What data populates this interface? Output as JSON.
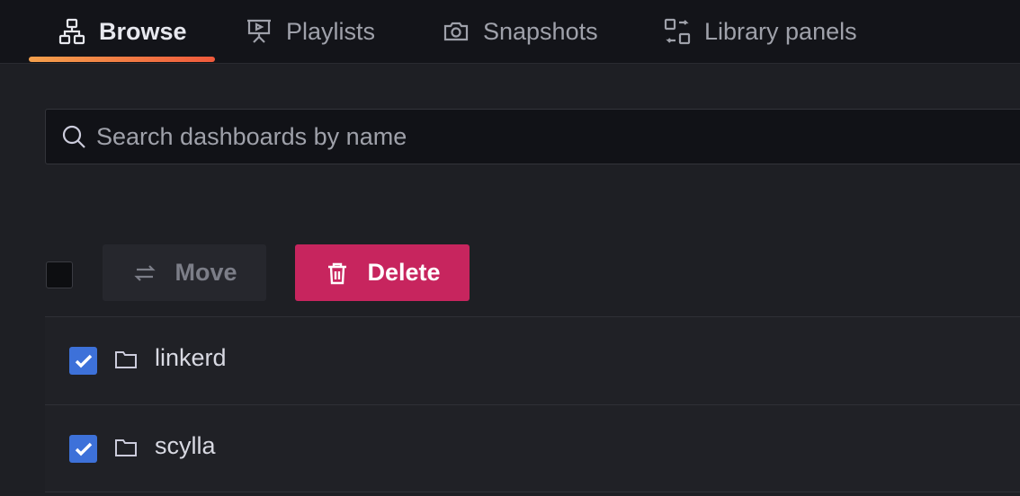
{
  "tabs": [
    {
      "label": "Browse",
      "icon": "sitemap-icon",
      "active": true
    },
    {
      "label": "Playlists",
      "icon": "presentation-icon",
      "active": false
    },
    {
      "label": "Snapshots",
      "icon": "camera-icon",
      "active": false
    },
    {
      "label": "Library panels",
      "icon": "apps-icon",
      "active": false
    }
  ],
  "search": {
    "placeholder": "Search dashboards by name",
    "value": ""
  },
  "actions": {
    "move_label": "Move",
    "delete_label": "Delete",
    "select_all_checked": false
  },
  "folders": [
    {
      "name": "linkerd",
      "checked": true
    },
    {
      "name": "scylla",
      "checked": true
    }
  ],
  "colors": {
    "accent_gradient_start": "#f4a04c",
    "accent_gradient_end": "#f05a3c",
    "delete_bg": "#c7255e",
    "checkbox_checked": "#3d71d9",
    "background": "#1e1f24"
  }
}
